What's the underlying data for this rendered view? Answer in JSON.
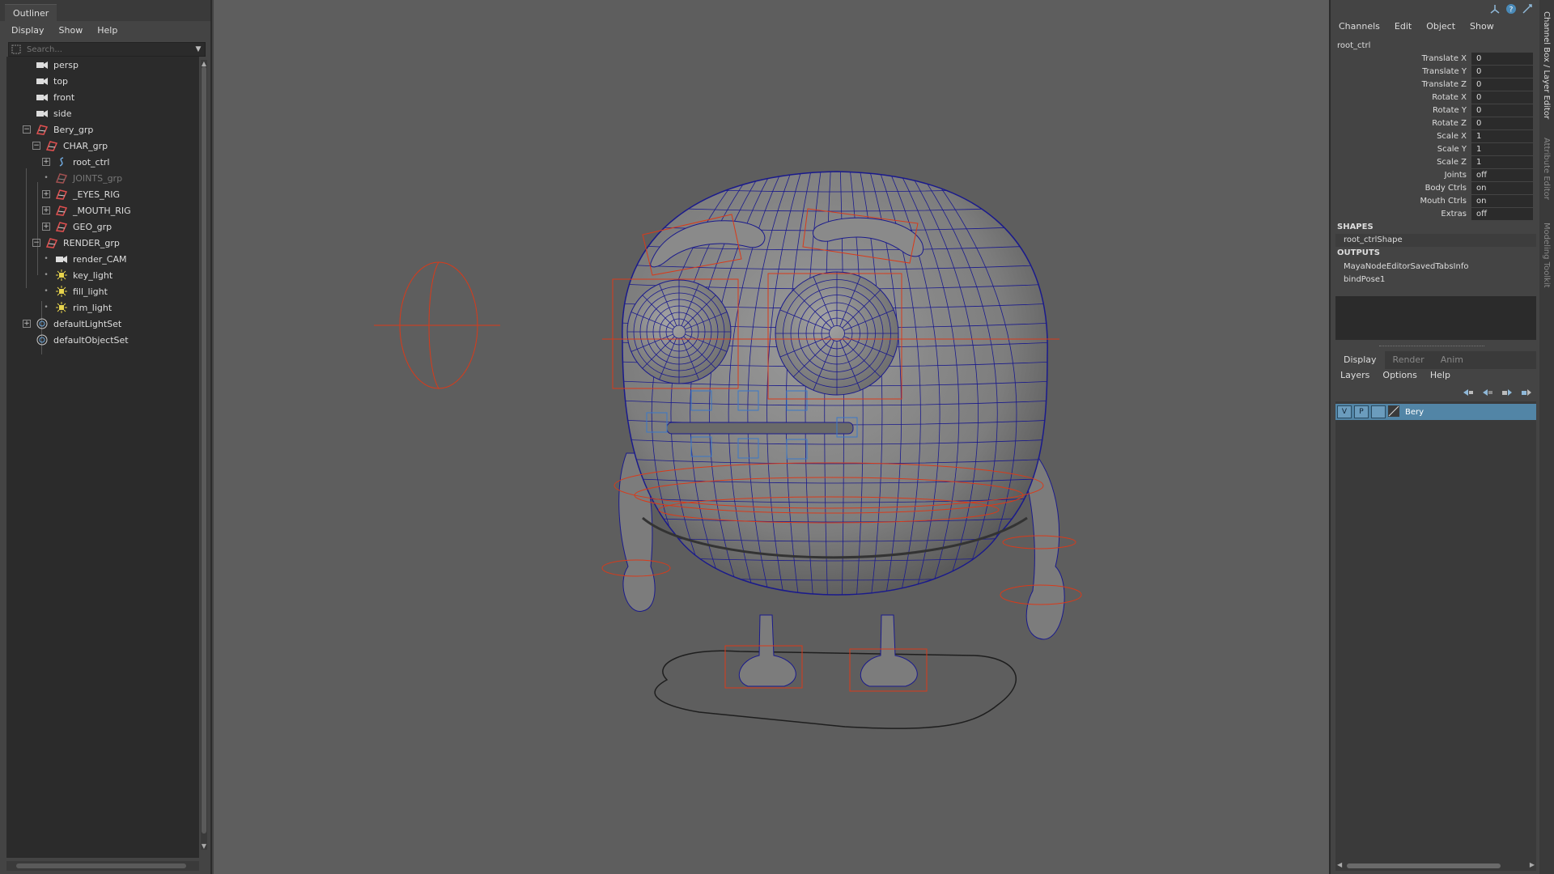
{
  "outliner": {
    "title": "Outliner",
    "menu": [
      "Display",
      "Show",
      "Help"
    ],
    "search_placeholder": "Search...",
    "items": [
      {
        "label": "persp",
        "icon": "camera-icon"
      },
      {
        "label": "top",
        "icon": "camera-icon"
      },
      {
        "label": "front",
        "icon": "camera-icon"
      },
      {
        "label": "side",
        "icon": "camera-icon"
      },
      {
        "label": "Bery_grp",
        "icon": "group-icon",
        "expander": "−"
      },
      {
        "label": "CHAR_grp",
        "icon": "group-icon",
        "expander": "−"
      },
      {
        "label": "root_ctrl",
        "icon": "curve-icon",
        "expander": "+"
      },
      {
        "label": "JOINTS_grp",
        "icon": "group-icon",
        "bullet": "•",
        "dimmed": true
      },
      {
        "label": "_EYES_RIG",
        "icon": "group-icon",
        "expander": "+"
      },
      {
        "label": "_MOUTH_RIG",
        "icon": "group-icon",
        "expander": "+"
      },
      {
        "label": "GEO_grp",
        "icon": "group-icon",
        "expander": "+"
      },
      {
        "label": "RENDER_grp",
        "icon": "group-icon",
        "expander": "−"
      },
      {
        "label": "render_CAM",
        "icon": "camera-icon",
        "bullet": "•"
      },
      {
        "label": "key_light",
        "icon": "light-icon",
        "bullet": "•"
      },
      {
        "label": "fill_light",
        "icon": "light-icon",
        "bullet": "•"
      },
      {
        "label": "rim_light",
        "icon": "light-icon",
        "bullet": "•"
      },
      {
        "label": "defaultLightSet",
        "icon": "set-icon",
        "expander": "+"
      },
      {
        "label": "defaultObjectSet",
        "icon": "set-icon"
      }
    ]
  },
  "channel_box": {
    "menu": [
      "Channels",
      "Edit",
      "Object",
      "Show"
    ],
    "node_name": "root_ctrl",
    "attributes": [
      {
        "label": "Translate X",
        "value": "0"
      },
      {
        "label": "Translate Y",
        "value": "0"
      },
      {
        "label": "Translate Z",
        "value": "0"
      },
      {
        "label": "Rotate X",
        "value": "0"
      },
      {
        "label": "Rotate Y",
        "value": "0"
      },
      {
        "label": "Rotate Z",
        "value": "0"
      },
      {
        "label": "Scale X",
        "value": "1"
      },
      {
        "label": "Scale Y",
        "value": "1"
      },
      {
        "label": "Scale Z",
        "value": "1"
      },
      {
        "label": "Joints",
        "value": "off"
      },
      {
        "label": "Body Ctrls",
        "value": "on"
      },
      {
        "label": "Mouth Ctrls",
        "value": "on"
      },
      {
        "label": "Extras",
        "value": "off"
      }
    ],
    "shapes_header": "SHAPES",
    "shapes": [
      "root_ctrlShape"
    ],
    "outputs_header": "OUTPUTS",
    "outputs": [
      "MayaNodeEditorSavedTabsInfo",
      "bindPose1"
    ]
  },
  "layer_editor": {
    "tabs": [
      "Display",
      "Render",
      "Anim"
    ],
    "active_tab": "Display",
    "menu": [
      "Layers",
      "Options",
      "Help"
    ],
    "layers": [
      {
        "visible": "V",
        "playback": "P",
        "name": "Bery",
        "color": "#5285a6"
      }
    ]
  },
  "side_tabs": [
    "Channel Box / Layer Editor",
    "Attribute Editor",
    "Modeling Toolkit"
  ],
  "colors": {
    "selection": "#5285a6",
    "wireframe": "#1a1a8c",
    "controls": "#d93a1a",
    "viewport_bg": "#5e5e5e"
  }
}
